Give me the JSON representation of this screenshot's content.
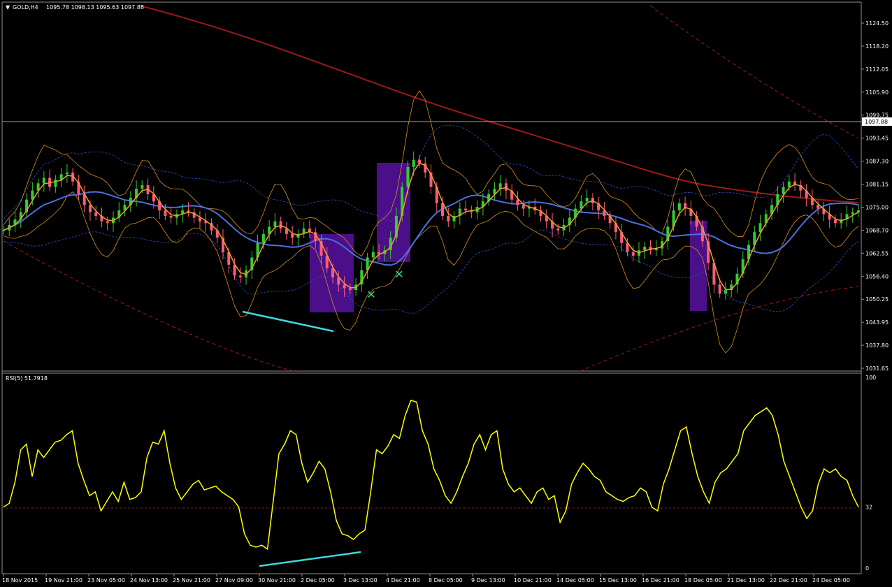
{
  "window": {
    "symbol_label": "GOLD,H4",
    "ohlc_label": "1095.78 1098.13 1095.63 1097.88",
    "dropdown_icon": "triangle-down-icon"
  },
  "price_panel": {
    "price_axis_ticks": [
      "1124.50",
      "1118.20",
      "1112.05",
      "1105.90",
      "1099.75",
      "1093.45",
      "1087.30",
      "1081.15",
      "1075.00",
      "1068.70",
      "1062.55",
      "1056.40",
      "1050.25",
      "1043.95",
      "1037.80",
      "1031.65"
    ],
    "current_price": "1097.88"
  },
  "rsi_panel": {
    "label": "RSI(5) 51.7918",
    "axis_ticks": [
      "100",
      "32",
      "0"
    ],
    "level": 32
  },
  "time_axis": [
    "18 Nov 2015",
    "19 Nov 21:00",
    "23 Nov 05:00",
    "24 Nov 13:00",
    "25 Nov 21:00",
    "27 Nov 09:00",
    "30 Nov 21:00",
    "2 Dec 05:00",
    "3 Dec 13:00",
    "4 Dec 21:00",
    "8 Dec 05:00",
    "9 Dec 13:00",
    "10 Dec 21:00",
    "14 Dec 05:00",
    "15 Dec 13:00",
    "16 Dec 21:00",
    "18 Dec 05:00",
    "21 Dec 13:00",
    "22 Dec 21:00",
    "24 Dec 05:00"
  ],
  "colors": {
    "background": "#000000",
    "bull_candle": "#32cd32",
    "bear_candle": "#ff5a7a",
    "ma_fast": "#f0a020",
    "ma_slow": "#4a70e0",
    "ma_long": "#a01818",
    "bands": "#d89020",
    "bands_outer": "#3050c0",
    "highlight": "#4b0f8a",
    "rsi_line": "#ffff00",
    "trend_line": "#40d8d8",
    "marker": "#20e090"
  },
  "chart_data": {
    "type": "line",
    "price": {
      "ylim": [
        1029.5,
        1130.5
      ],
      "values": [
        1068.0,
        1069.5,
        1071.0,
        1073.0,
        1076.5,
        1079.0,
        1081.0,
        1082.5,
        1080.0,
        1082.0,
        1083.5,
        1084.0,
        1081.5,
        1078.0,
        1075.0,
        1073.0,
        1072.0,
        1070.5,
        1070.0,
        1071.5,
        1073.5,
        1075.0,
        1077.0,
        1079.5,
        1080.5,
        1078.0,
        1076.0,
        1073.5,
        1072.0,
        1071.5,
        1072.5,
        1073.5,
        1073.0,
        1071.5,
        1070.5,
        1070.0,
        1068.0,
        1066.0,
        1062.0,
        1058.5,
        1055.5,
        1055.0,
        1057.0,
        1060.5,
        1064.5,
        1067.0,
        1069.0,
        1070.5,
        1068.5,
        1067.0,
        1066.0,
        1067.0,
        1068.5,
        1067.5,
        1065.0,
        1061.0,
        1057.5,
        1055.0,
        1053.0,
        1052.0,
        1051.5,
        1053.0,
        1057.0,
        1060.5,
        1062.0,
        1061.5,
        1062.5,
        1066.0,
        1072.0,
        1080.0,
        1085.5,
        1087.5,
        1086.5,
        1084.0,
        1080.0,
        1075.5,
        1072.0,
        1070.5,
        1072.0,
        1074.0,
        1073.5,
        1073.0,
        1074.5,
        1076.0,
        1078.0,
        1079.5,
        1081.0,
        1079.0,
        1076.5,
        1075.0,
        1074.0,
        1074.5,
        1073.5,
        1072.0,
        1070.5,
        1068.5,
        1068.0,
        1069.5,
        1071.5,
        1074.0,
        1076.0,
        1077.0,
        1075.5,
        1073.5,
        1072.0,
        1070.0,
        1067.5,
        1064.5,
        1062.0,
        1061.0,
        1062.5,
        1063.5,
        1062.5,
        1063.0,
        1065.0,
        1069.0,
        1073.5,
        1075.5,
        1074.0,
        1072.0,
        1069.0,
        1065.0,
        1059.0,
        1053.0,
        1050.5,
        1051.5,
        1053.0,
        1056.0,
        1060.0,
        1064.0,
        1067.5,
        1070.0,
        1072.5,
        1075.0,
        1078.0,
        1080.0,
        1081.5,
        1080.5,
        1079.0,
        1077.0,
        1075.0,
        1074.0,
        1072.5,
        1071.0,
        1070.0,
        1071.0,
        1072.5,
        1073.0,
        1073.5
      ]
    },
    "rsi": {
      "ylim": [
        0,
        100
      ],
      "values": [
        32,
        34,
        45,
        62,
        65,
        48,
        62,
        58,
        62,
        66,
        67,
        70,
        72,
        55,
        46,
        38,
        40,
        30,
        35,
        40,
        35,
        45,
        36,
        37,
        40,
        58,
        66,
        65,
        72,
        55,
        42,
        36,
        40,
        44,
        46,
        41,
        42,
        43,
        40,
        38,
        36,
        32,
        18,
        12,
        11,
        12,
        10,
        35,
        60,
        65,
        72,
        70,
        55,
        45,
        50,
        56,
        52,
        40,
        25,
        18,
        17,
        15,
        18,
        20,
        40,
        62,
        60,
        64,
        70,
        68,
        80,
        88,
        87,
        72,
        65,
        52,
        46,
        38,
        34,
        40,
        48,
        55,
        65,
        70,
        62,
        70,
        72,
        52,
        44,
        40,
        42,
        38,
        34,
        40,
        42,
        36,
        38,
        24,
        30,
        44,
        50,
        55,
        52,
        48,
        46,
        40,
        38,
        36,
        35,
        37,
        38,
        42,
        40,
        32,
        30,
        44,
        52,
        62,
        72,
        74,
        60,
        48,
        40,
        34,
        45,
        50,
        52,
        56,
        60,
        72,
        76,
        80,
        82,
        84,
        80,
        70,
        56,
        48,
        40,
        32,
        26,
        30,
        44,
        52,
        50,
        52,
        48,
        46,
        38,
        32
      ]
    }
  }
}
